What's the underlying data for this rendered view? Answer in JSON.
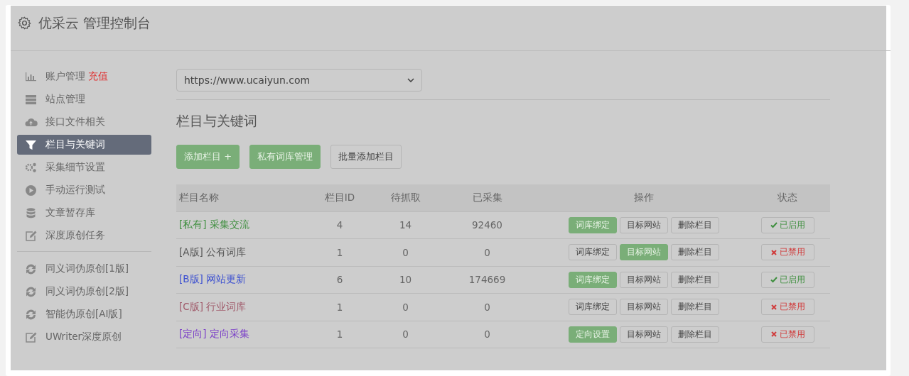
{
  "header": {
    "title": "优采云 管理控制台"
  },
  "sidebar": {
    "items": [
      {
        "label": "账户管理",
        "badge": "充值",
        "selected": false
      },
      {
        "label": "站点管理",
        "selected": false
      },
      {
        "label": "接口文件相关",
        "selected": false
      },
      {
        "label": "栏目与关键词",
        "selected": true
      },
      {
        "label": "采集细节设置",
        "selected": false
      },
      {
        "label": "手动运行测试",
        "selected": false
      },
      {
        "label": "文章暂存库",
        "selected": false
      },
      {
        "label": "深度原创任务",
        "selected": false
      }
    ],
    "tools": [
      {
        "label": "同义词伪原创[1版]"
      },
      {
        "label": "同义词伪原创[2版]"
      },
      {
        "label": "智能伪原创[AI版]"
      },
      {
        "label": "UWriter深度原创"
      }
    ]
  },
  "site_select": {
    "value": "https://www.ucaiyun.com"
  },
  "section_title": "栏目与关键词",
  "toolbar": [
    {
      "label": "添加栏目 +",
      "primary": true
    },
    {
      "label": "私有词库管理",
      "primary": true
    },
    {
      "label": "批量添加栏目",
      "primary": false
    }
  ],
  "table": {
    "columns": [
      "栏目名称",
      "栏目ID",
      "待抓取",
      "已采集",
      "操作",
      "状态"
    ],
    "rows": [
      {
        "tag": "[私有]",
        "name": "采集交流",
        "color": "#3f8f3f",
        "id": "4",
        "pending": "14",
        "collected": "92460",
        "actions": [
          {
            "label": "词库绑定",
            "selected": true
          },
          {
            "label": "目标网站",
            "selected": false
          },
          {
            "label": "删除栏目",
            "selected": false
          }
        ],
        "status": {
          "label": "已启用",
          "enabled": true
        }
      },
      {
        "tag": "[A版]",
        "name": "公有词库",
        "color": "#555555",
        "id": "1",
        "pending": "0",
        "collected": "0",
        "actions": [
          {
            "label": "词库绑定",
            "selected": false
          },
          {
            "label": "目标网站",
            "selected": true
          },
          {
            "label": "删除栏目",
            "selected": false
          }
        ],
        "status": {
          "label": "已禁用",
          "enabled": false
        }
      },
      {
        "tag": "[B版]",
        "name": "网站更新",
        "color": "#3b4fd0",
        "id": "6",
        "pending": "10",
        "collected": "174669",
        "actions": [
          {
            "label": "词库绑定",
            "selected": true
          },
          {
            "label": "目标网站",
            "selected": false
          },
          {
            "label": "删除栏目",
            "selected": false
          }
        ],
        "status": {
          "label": "已启用",
          "enabled": true
        }
      },
      {
        "tag": "[C版]",
        "name": "行业词库",
        "color": "#a05a6a",
        "id": "1",
        "pending": "0",
        "collected": "0",
        "actions": [
          {
            "label": "词库绑定",
            "selected": false
          },
          {
            "label": "目标网站",
            "selected": false
          },
          {
            "label": "删除栏目",
            "selected": false
          }
        ],
        "status": {
          "label": "已禁用",
          "enabled": false
        }
      },
      {
        "tag": "[定向]",
        "name": "定向采集",
        "color": "#7b3fc8",
        "id": "1",
        "pending": "0",
        "collected": "0",
        "actions": [
          {
            "label": "定向设置",
            "selected": true
          },
          {
            "label": "目标网站",
            "selected": false
          },
          {
            "label": "删除栏目",
            "selected": false
          }
        ],
        "status": {
          "label": "已禁用",
          "enabled": false
        }
      }
    ]
  }
}
